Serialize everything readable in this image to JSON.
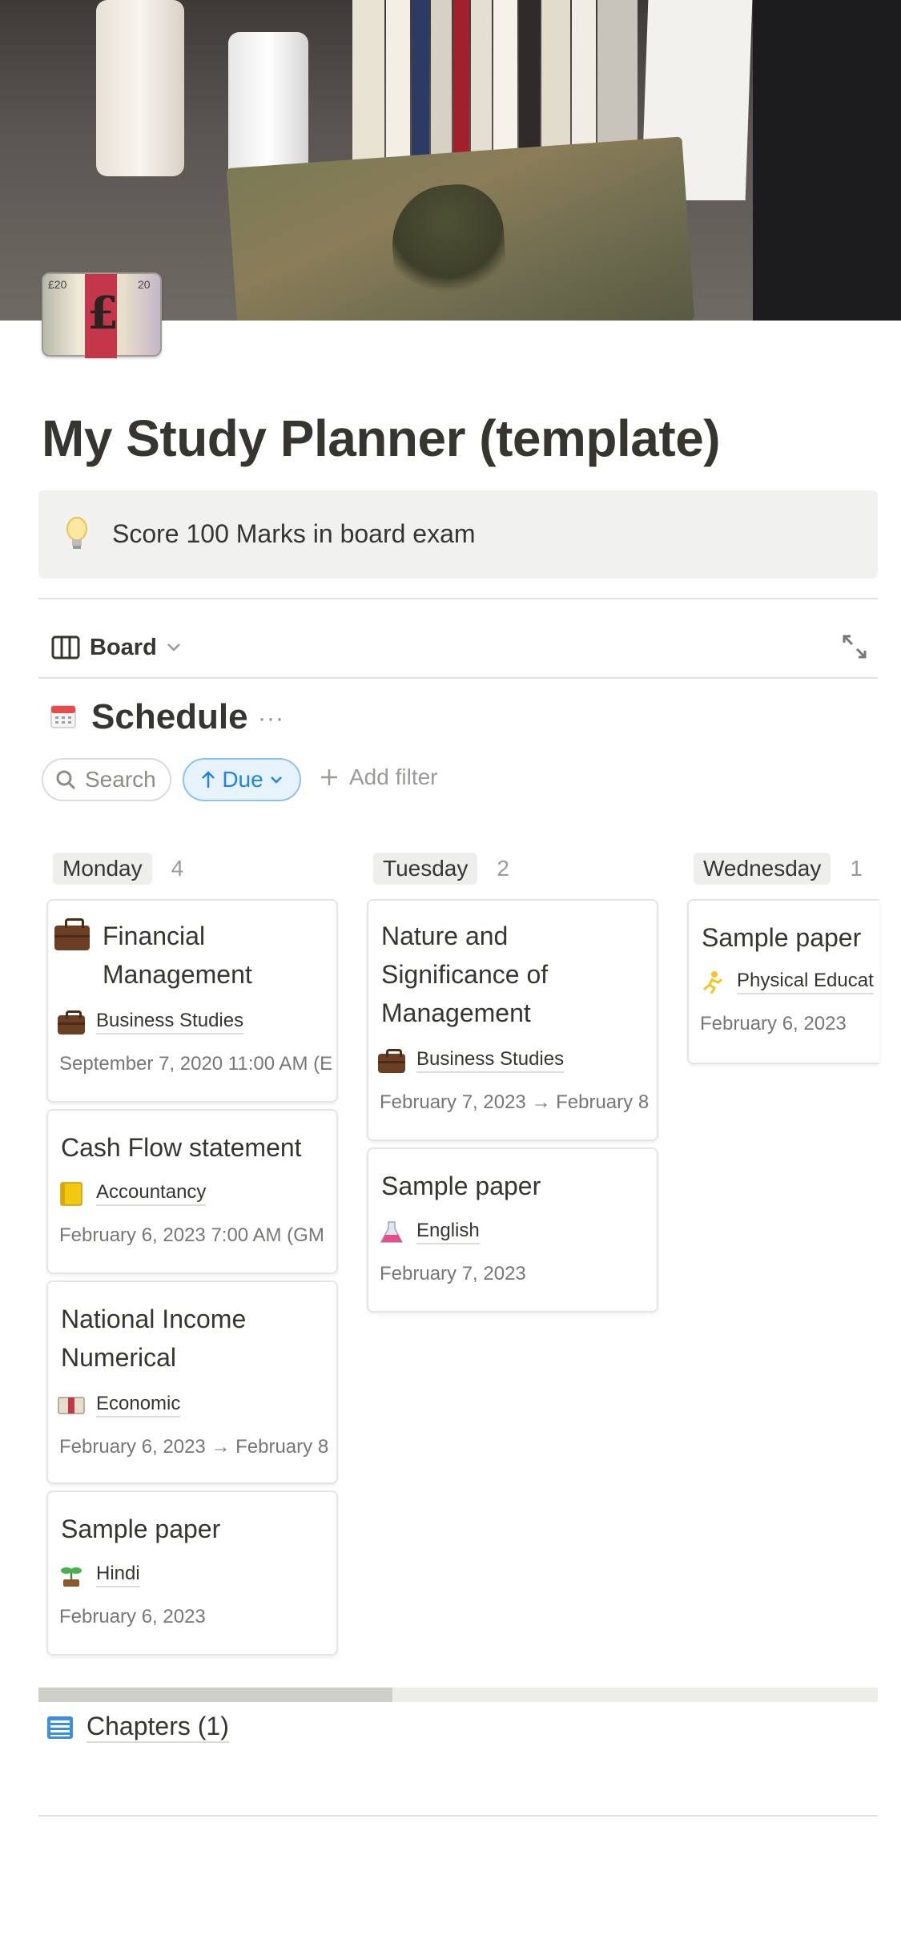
{
  "page": {
    "title": "My Study Planner (template)",
    "callout": "Score 100 Marks in board exam",
    "icon": "pound-banknote-icon"
  },
  "view": {
    "label": "Board"
  },
  "database": {
    "title": "Schedule",
    "more": "···",
    "search_label": "Search",
    "sort_label": "Due",
    "add_filter_label": "Add filter"
  },
  "columns": [
    {
      "name": "Monday",
      "count": "4",
      "cards": [
        {
          "title_line1": "Financial",
          "title_line2": "Management",
          "subject": "Business Studies",
          "subject_icon": "briefcase-icon",
          "date": "September 7, 2020 11:00 AM (E"
        },
        {
          "title_line1": "Cash Flow statement",
          "subject": "Accountancy",
          "subject_icon": "ledger-icon",
          "date": "February 6, 2023 7:00 AM (GM"
        },
        {
          "title_line1": "National Income",
          "title_line2": "Numerical",
          "subject": "Economic",
          "subject_icon": "banknote-icon",
          "date": "February 6, 2023 → February 8"
        },
        {
          "title_line1": "Sample paper",
          "subject": "Hindi",
          "subject_icon": "seedling-icon",
          "date": "February 6, 2023"
        }
      ]
    },
    {
      "name": "Tuesday",
      "count": "2",
      "cards": [
        {
          "title_line1": "Nature and",
          "title_line2": "Significance of",
          "title_line3": "Management",
          "subject": "Business Studies",
          "subject_icon": "briefcase-icon",
          "date": "February 7, 2023 → February 8"
        },
        {
          "title_line1": "Sample paper",
          "subject": "English",
          "subject_icon": "flask-icon",
          "date": "February 7, 2023"
        }
      ]
    },
    {
      "name": "Wednesday",
      "count": "1",
      "cards": [
        {
          "title_line1": "Sample paper",
          "subject": "Physical Educat",
          "subject_icon": "runner-icon",
          "date": "February 6, 2023"
        }
      ]
    }
  ],
  "chapters": {
    "label": "Chapters (1)"
  },
  "colors": {
    "accent_blue": "#2383e2",
    "text": "#37352f",
    "muted": "#787774"
  }
}
